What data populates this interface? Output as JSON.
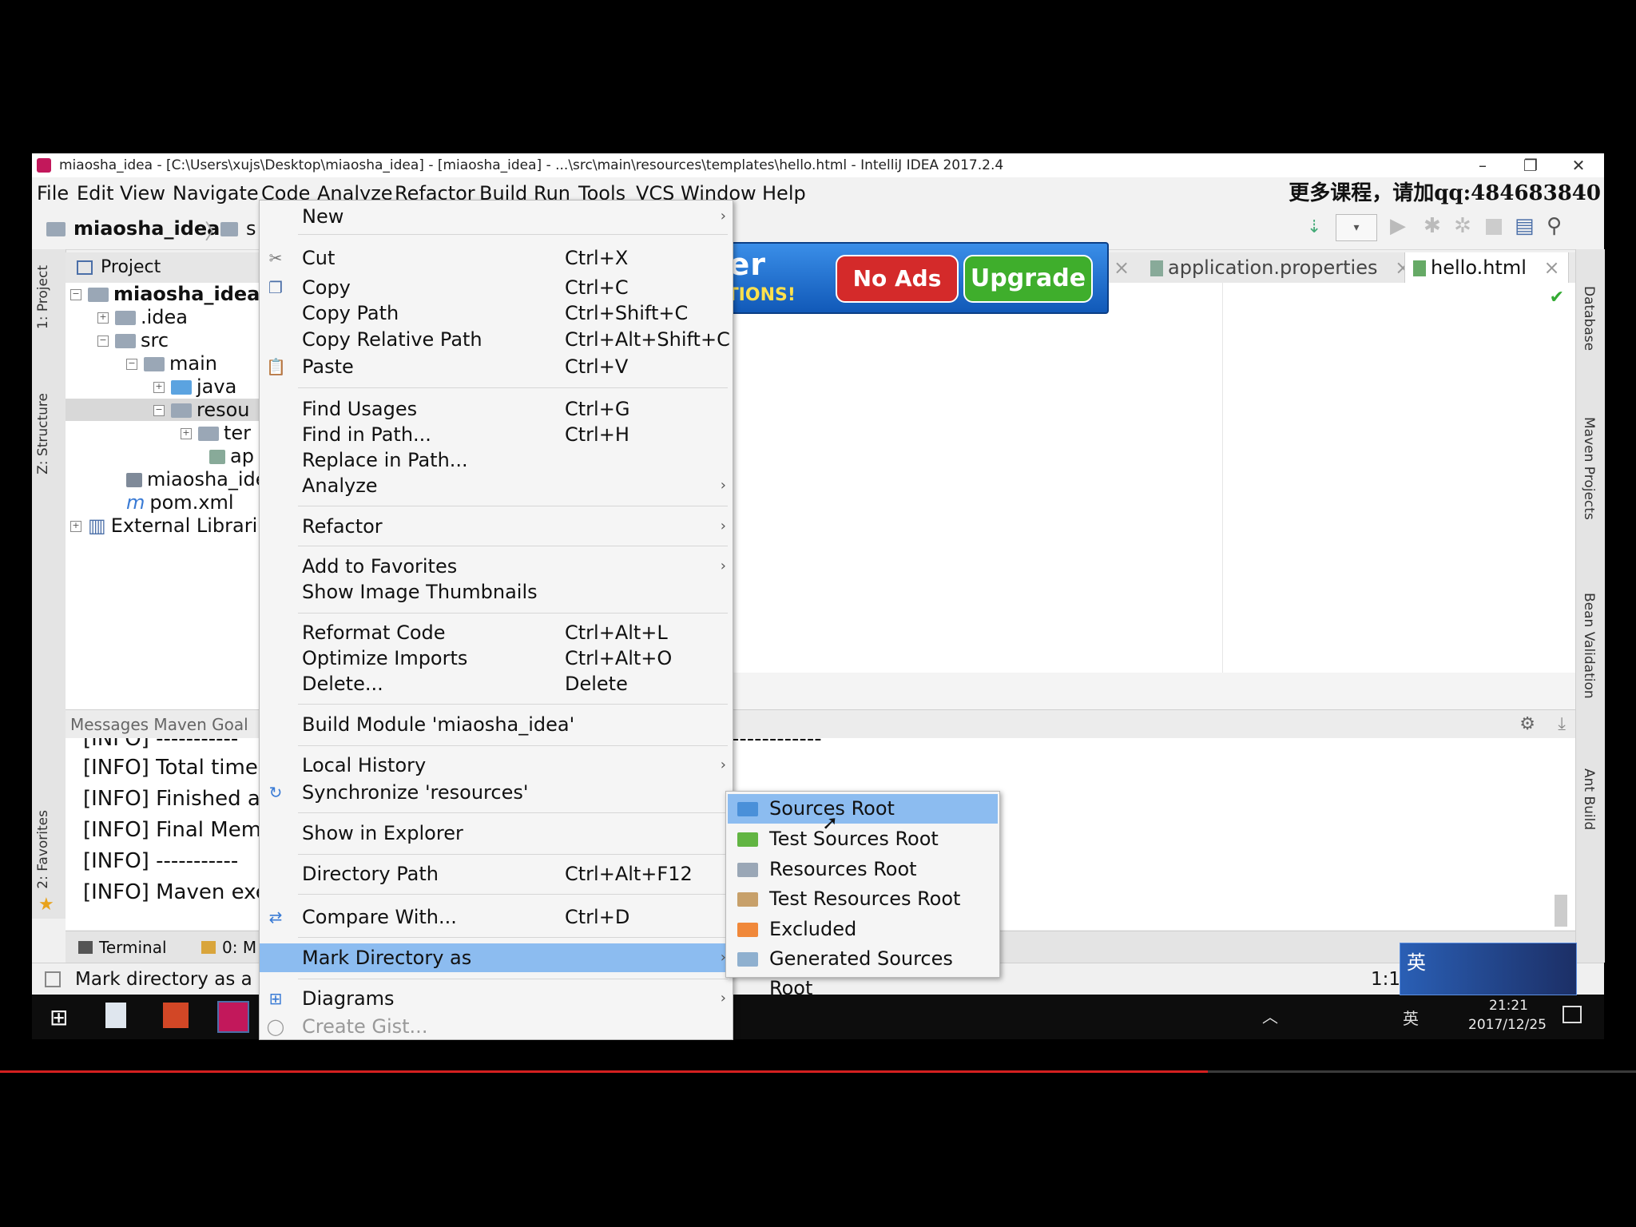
{
  "window": {
    "title": "miaosha_idea - [C:\\Users\\xujs\\Desktop\\miaosha_idea] - [miaosha_idea] - ...\\src\\main\\resources\\templates\\hello.html - IntelliJ IDEA 2017.2.4",
    "minimize": "–",
    "restore": "❐",
    "close": "✕"
  },
  "menubar": {
    "items": [
      "File",
      "Edit",
      "View",
      "Navigate",
      "Code",
      "Analyze",
      "Refactor",
      "Build",
      "Run",
      "Tools",
      "VCS",
      "Window",
      "Help"
    ],
    "promo": "更多课程，请加qq:484683840"
  },
  "navbar": {
    "project": "miaosha_idea",
    "next": "s"
  },
  "left_stripe": {
    "project_tab": "1: Project",
    "structure_tab": "Z: Structure",
    "favorites_tab": "2: Favorites"
  },
  "project_panel": {
    "header": "Project",
    "tree": [
      {
        "label": "miaosha_idea",
        "bold": true
      },
      {
        "label": ".idea"
      },
      {
        "label": "src"
      },
      {
        "label": "main"
      },
      {
        "label": "java"
      },
      {
        "label": "resou"
      },
      {
        "label": "ter"
      },
      {
        "label": "ap"
      },
      {
        "label": "miaosha_ide"
      },
      {
        "label": "pom.xml"
      },
      {
        "label": "External Librari"
      }
    ]
  },
  "editor": {
    "tabs": [
      "application.properties",
      "hello.html"
    ],
    "tab_close": "×"
  },
  "messages": {
    "header": "Messages Maven Goal",
    "lines": [
      "[INFO] -----------",
      "[INFO] Total time:",
      "[INFO] Finished a",
      "[INFO] Final Mem",
      "[INFO] -----------",
      "[INFO] Maven exe"
    ],
    "dashes_right": "------------"
  },
  "bottom_tabs": {
    "terminal": "Terminal",
    "messages": "0: M"
  },
  "statusbar": {
    "text": "Mark directory as a s",
    "position": "1:1"
  },
  "right_stripe": {
    "database": "Database",
    "maven": "Maven Projects",
    "bean": "Bean Validation",
    "ant": "Ant Build"
  },
  "ad": {
    "brand": "BSPlayer",
    "tagline": "MORE FUNCTIONS!",
    "no_ads": "No Ads",
    "upgrade": "Upgrade"
  },
  "context_menu": {
    "items": [
      {
        "label": "New",
        "shortcut": "",
        "submenu": true
      },
      {
        "label": "Cut",
        "shortcut": "Ctrl+X"
      },
      {
        "label": "Copy",
        "shortcut": "Ctrl+C"
      },
      {
        "label": "Copy Path",
        "shortcut": "Ctrl+Shift+C"
      },
      {
        "label": "Copy Relative Path",
        "shortcut": "Ctrl+Alt+Shift+C"
      },
      {
        "label": "Paste",
        "shortcut": "Ctrl+V"
      },
      {
        "label": "Find Usages",
        "shortcut": "Ctrl+G"
      },
      {
        "label": "Find in Path...",
        "shortcut": "Ctrl+H"
      },
      {
        "label": "Replace in Path...",
        "shortcut": ""
      },
      {
        "label": "Analyze",
        "shortcut": "",
        "submenu": true
      },
      {
        "label": "Refactor",
        "shortcut": "",
        "submenu": true
      },
      {
        "label": "Add to Favorites",
        "shortcut": "",
        "submenu": true
      },
      {
        "label": "Show Image Thumbnails",
        "shortcut": ""
      },
      {
        "label": "Reformat Code",
        "shortcut": "Ctrl+Alt+L"
      },
      {
        "label": "Optimize Imports",
        "shortcut": "Ctrl+Alt+O"
      },
      {
        "label": "Delete...",
        "shortcut": "Delete"
      },
      {
        "label": "Build Module 'miaosha_idea'",
        "shortcut": ""
      },
      {
        "label": "Local History",
        "shortcut": "",
        "submenu": true
      },
      {
        "label": "Synchronize 'resources'",
        "shortcut": ""
      },
      {
        "label": "Show in Explorer",
        "shortcut": ""
      },
      {
        "label": "Directory Path",
        "shortcut": "Ctrl+Alt+F12"
      },
      {
        "label": "Compare With...",
        "shortcut": "Ctrl+D"
      },
      {
        "label": "Mark Directory as",
        "shortcut": "",
        "submenu": true,
        "selected": true
      },
      {
        "label": "Diagrams",
        "shortcut": "",
        "submenu": true
      },
      {
        "label": "Create Gist...",
        "shortcut": ""
      }
    ]
  },
  "submenu": {
    "items": [
      {
        "label": "Sources Root",
        "color": "#4a90d9",
        "selected": true
      },
      {
        "label": "Test Sources Root",
        "color": "#62b543"
      },
      {
        "label": "Resources Root",
        "color": "#9aa7b6"
      },
      {
        "label": "Test Resources Root",
        "color": "#c7a06a"
      },
      {
        "label": "Excluded",
        "color": "#f0883a"
      },
      {
        "label": "Generated Sources Root",
        "color": "#8fb0cf"
      }
    ]
  },
  "taskbar": {
    "ime": "英",
    "time": "21:21",
    "date": "2017/12/25"
  },
  "colors": {
    "selection": "#8cbcf0",
    "promo": "#e0201a"
  }
}
